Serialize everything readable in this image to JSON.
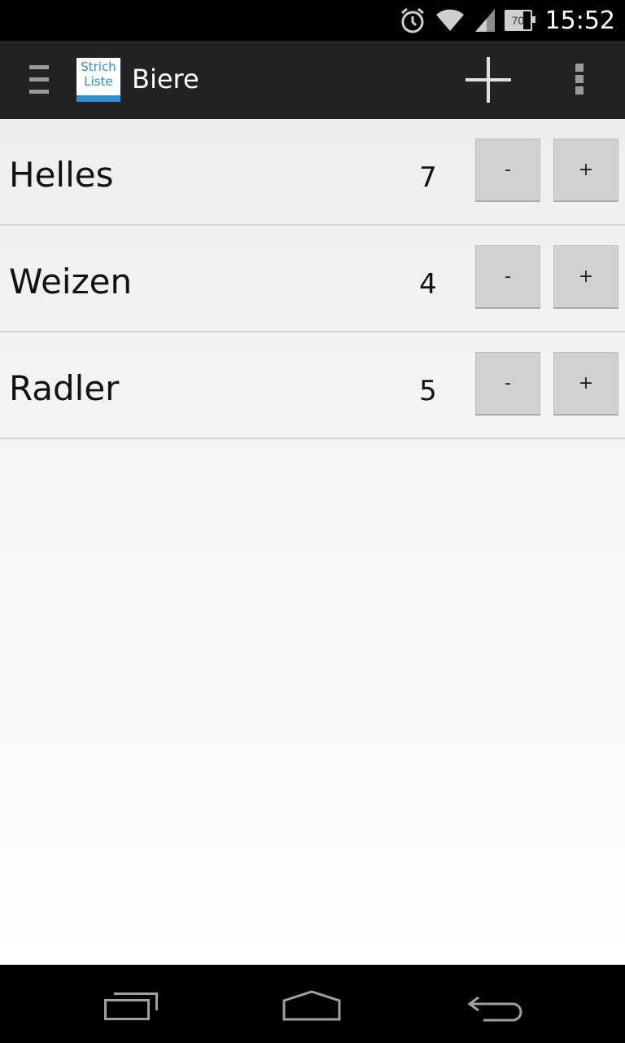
{
  "status_bar": {
    "time": "15:52",
    "battery_level": "70",
    "icons": [
      "alarm-icon",
      "wifi-icon",
      "signal-icon",
      "battery-icon"
    ]
  },
  "action_bar": {
    "logo_line1": "Strich",
    "logo_line2": "Liste",
    "title": "Biere",
    "icons": [
      "drawer-icon",
      "add-icon",
      "overflow-menu-icon"
    ]
  },
  "items": [
    {
      "name": "Helles",
      "count": "7",
      "minus_label": "-",
      "plus_label": "+"
    },
    {
      "name": "Weizen",
      "count": "4",
      "minus_label": "-",
      "plus_label": "+"
    },
    {
      "name": "Radler",
      "count": "5",
      "minus_label": "-",
      "plus_label": "+"
    }
  ],
  "nav_bar": {
    "icons": [
      "recent-apps-icon",
      "home-icon",
      "back-icon"
    ]
  },
  "colors": {
    "action_bar_bg": "#222222",
    "logo_accent": "#2b8fd6",
    "button_bg": "#d1d1d1"
  }
}
